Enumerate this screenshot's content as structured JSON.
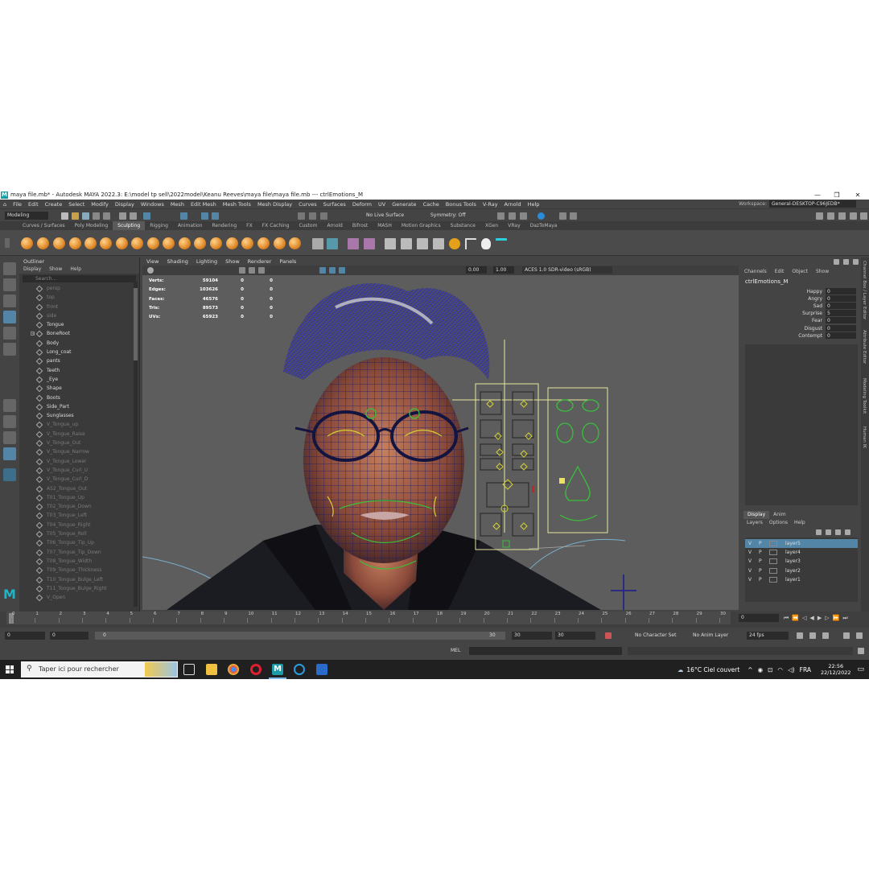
{
  "window": {
    "title": "maya file.mb* - Autodesk MAYA 2022.3: E:\\model tp sell\\2022model\\Keanu Reeves\\maya file\\maya file.mb  ---  ctrlEmotions_M",
    "logo": "M"
  },
  "menubar": {
    "items": [
      "File",
      "Edit",
      "Create",
      "Select",
      "Modify",
      "Display",
      "Windows",
      "Mesh",
      "Edit Mesh",
      "Mesh Tools",
      "Mesh Display",
      "Curves",
      "Surfaces",
      "Deform",
      "UV",
      "Generate",
      "Cache",
      "Bonus Tools",
      "V-Ray",
      "Arnold",
      "Help"
    ],
    "workspace_label": "Workspace:",
    "workspace_value": "General-DESKTOP-C96JEDB*"
  },
  "statusline": {
    "mode": "Modeling",
    "live_surface": "No Live Surface",
    "symmetry": "Symmetry: Off"
  },
  "shelf": {
    "tabs": [
      "Curves / Surfaces",
      "Poly Modeling",
      "Sculpting",
      "Rigging",
      "Animation",
      "Rendering",
      "FX",
      "FX Caching",
      "Custom",
      "Arnold",
      "Bifrost",
      "MASH",
      "Motion Graphics",
      "Substance",
      "XGen",
      "VRay",
      "DazToMaya"
    ],
    "active_tab": "Sculpting"
  },
  "outliner": {
    "title": "Outliner",
    "menu": [
      "Display",
      "Show",
      "Help"
    ],
    "search_placeholder": "Search...",
    "items": [
      {
        "name": "persp",
        "dim": true
      },
      {
        "name": "top",
        "dim": true
      },
      {
        "name": "front",
        "dim": true
      },
      {
        "name": "side",
        "dim": true
      },
      {
        "name": "Tongue",
        "dim": false
      },
      {
        "name": "BoneRoot",
        "dim": false,
        "expand": true
      },
      {
        "name": "Body",
        "dim": false
      },
      {
        "name": "Long_coat",
        "dim": false
      },
      {
        "name": "pants",
        "dim": false
      },
      {
        "name": "Teeth",
        "dim": false
      },
      {
        "name": "_Eye",
        "dim": false
      },
      {
        "name": "Shape",
        "dim": false
      },
      {
        "name": "Boots",
        "dim": false
      },
      {
        "name": "Side_Part",
        "dim": false
      },
      {
        "name": "Sunglasses",
        "dim": false
      },
      {
        "name": "V_Tongue_up",
        "dim": true
      },
      {
        "name": "V_Tongue_Raise",
        "dim": true
      },
      {
        "name": "V_Tongue_Out",
        "dim": true
      },
      {
        "name": "V_Tongue_Narrow",
        "dim": true
      },
      {
        "name": "V_Tongue_Lower",
        "dim": true
      },
      {
        "name": "V_Tongue_Curl_U",
        "dim": true
      },
      {
        "name": "V_Tongue_Curl_D",
        "dim": true
      },
      {
        "name": "A52_Tongue_Out",
        "dim": true
      },
      {
        "name": "T01_Tongue_Up",
        "dim": true
      },
      {
        "name": "T02_Tongue_Down",
        "dim": true
      },
      {
        "name": "T03_Tongue_Left",
        "dim": true
      },
      {
        "name": "T04_Tongue_Right",
        "dim": true
      },
      {
        "name": "T05_Tongue_Roll",
        "dim": true
      },
      {
        "name": "T06_Tongue_Tip_Up",
        "dim": true
      },
      {
        "name": "T07_Tongue_Tip_Down",
        "dim": true
      },
      {
        "name": "T08_Tongue_Width",
        "dim": true
      },
      {
        "name": "T09_Tongue_Thickness",
        "dim": true
      },
      {
        "name": "T10_Tongue_Bulge_Left",
        "dim": true
      },
      {
        "name": "T11_Tongue_Bulge_Right",
        "dim": true
      },
      {
        "name": "V_Open",
        "dim": true
      }
    ]
  },
  "viewport": {
    "menu": [
      "View",
      "Shading",
      "Lighting",
      "Show",
      "Renderer",
      "Panels"
    ],
    "exposure": "0.00",
    "gamma": "1.00",
    "color_space": "ACES 1.0 SDR-video (sRGB)",
    "hud": [
      {
        "label": "Verts:",
        "value": "59104",
        "a": "0",
        "b": "0"
      },
      {
        "label": "Edges:",
        "value": "103626",
        "a": "0",
        "b": "0"
      },
      {
        "label": "Faces:",
        "value": "46576",
        "a": "0",
        "b": "0"
      },
      {
        "label": "Tris:",
        "value": "89573",
        "a": "0",
        "b": "0"
      },
      {
        "label": "UVs:",
        "value": "65923",
        "a": "0",
        "b": "0"
      }
    ]
  },
  "channelbox": {
    "menu": [
      "Channels",
      "Edit",
      "Object",
      "Show"
    ],
    "node": "ctrlEmotions_M",
    "channels": [
      {
        "name": "Happy",
        "value": "0"
      },
      {
        "name": "Angry",
        "value": "0"
      },
      {
        "name": "Sad",
        "value": "0"
      },
      {
        "name": "Surprise",
        "value": "5"
      },
      {
        "name": "Fear",
        "value": "0"
      },
      {
        "name": "Disgust",
        "value": "0"
      },
      {
        "name": "Contempt",
        "value": "0"
      }
    ],
    "layer_tabs": [
      "Display",
      "Anim"
    ],
    "layer_menu": [
      "Layers",
      "Options",
      "Help"
    ],
    "layers": [
      {
        "v": "V",
        "p": "P",
        "name": "layer5",
        "selected": true
      },
      {
        "v": "V",
        "p": "P",
        "name": "layer4",
        "selected": false
      },
      {
        "v": "V",
        "p": "P",
        "name": "layer3",
        "selected": false
      },
      {
        "v": "V",
        "p": "P",
        "name": "layer2",
        "selected": false
      },
      {
        "v": "V",
        "p": "P",
        "name": "layer1",
        "selected": false
      }
    ],
    "side_tabs": [
      "Channel Box / Layer Editor",
      "Attribute Editor",
      "Modeling Toolkit",
      "Human IK"
    ]
  },
  "timeline": {
    "ticks": [
      "0",
      "1",
      "2",
      "3",
      "4",
      "5",
      "6",
      "7",
      "8",
      "9",
      "10",
      "11",
      "12",
      "13",
      "14",
      "15",
      "16",
      "17",
      "18",
      "19",
      "20",
      "21",
      "22",
      "23",
      "24",
      "25",
      "26",
      "27",
      "28",
      "29",
      "30"
    ],
    "current_frame": "0"
  },
  "range": {
    "start": "0",
    "start_inner": "0",
    "slider_start": "0",
    "slider_end": "30",
    "end_inner": "30",
    "end": "30",
    "character_set": "No Character Set",
    "anim_layer": "No Anim Layer",
    "fps": "24 fps"
  },
  "cmdline": {
    "label": "MEL"
  },
  "taskbar": {
    "search_placeholder": "Taper ici pour rechercher",
    "weather": "16°C  Ciel couvert",
    "language": "FRA",
    "time": "22:56",
    "date": "22/12/2022"
  }
}
